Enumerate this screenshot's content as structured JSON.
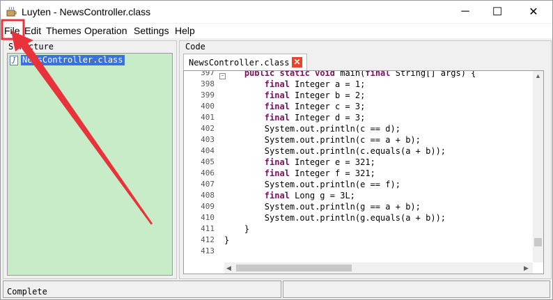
{
  "window": {
    "title": "Luyten - NewsController.class",
    "minimize_glyph": "─",
    "maximize_glyph": "☐",
    "close_glyph": "✕"
  },
  "menu": [
    "File",
    "Edit",
    "Themes",
    "Operation",
    "Settings",
    "Help"
  ],
  "structure": {
    "label": "Structure",
    "items": [
      {
        "label": "NewsController.class",
        "icon": "java-file-icon"
      }
    ]
  },
  "code": {
    "label": "Code",
    "tab_label": "NewsController.class",
    "tab_close_glyph": "✕",
    "lines": [
      {
        "num": "397",
        "text": "    public static void main(final String[] args) {"
      },
      {
        "num": "398",
        "text": "        final Integer a = 1;"
      },
      {
        "num": "399",
        "text": "        final Integer b = 2;"
      },
      {
        "num": "400",
        "text": "        final Integer c = 3;"
      },
      {
        "num": "401",
        "text": "        final Integer d = 3;"
      },
      {
        "num": "402",
        "text": "        System.out.println(c == d);"
      },
      {
        "num": "403",
        "text": "        System.out.println(c == a + b);"
      },
      {
        "num": "404",
        "text": "        System.out.println(c.equals(a + b));"
      },
      {
        "num": "405",
        "text": "        final Integer e = 321;"
      },
      {
        "num": "406",
        "text": "        final Integer f = 321;"
      },
      {
        "num": "407",
        "text": "        System.out.println(e == f);"
      },
      {
        "num": "408",
        "text": "        final Long g = 3L;"
      },
      {
        "num": "409",
        "text": "        System.out.println(g == a + b);"
      },
      {
        "num": "410",
        "text": "        System.out.println(g.equals(a + b));"
      },
      {
        "num": "411",
        "text": "    }"
      },
      {
        "num": "412",
        "text": "}"
      },
      {
        "num": "413",
        "text": ""
      }
    ],
    "keywords": [
      "public",
      "static",
      "void",
      "final"
    ],
    "keyword_color": "#7a1060"
  },
  "status": {
    "text": "Complete"
  },
  "annotation": {
    "color": "#e8333a"
  }
}
